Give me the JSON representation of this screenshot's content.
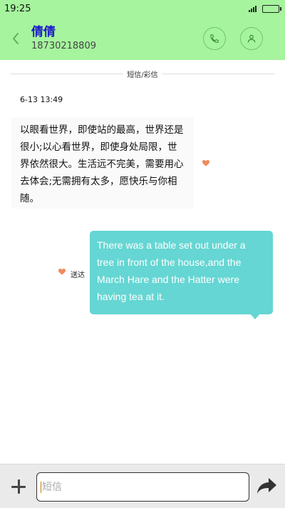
{
  "status_bar": {
    "time": "19:25",
    "signal_icon": "signal-icon",
    "battery_icon": "battery-icon"
  },
  "header": {
    "contact_name": "倩倩",
    "contact_number": "18730218809",
    "back_icon": "chevron-left-icon",
    "call_icon": "phone-icon",
    "profile_icon": "person-icon"
  },
  "conversation": {
    "divider_label": "短信/彩信",
    "timestamp": "6-13 13:49",
    "incoming_message": "以眼看世界，即使站的最高，世界还是很小;以心看世界，即使身处局限，世界依然很大。生活远不完美，需要用心去体会;无需拥有太多，愿快乐与你相随。",
    "outgoing_message": "There was a table set out under a tree in front of the house,and the March Hare and the Hatter were having tea at it.",
    "outgoing_status": "送达",
    "heart_icon": "heart-icon"
  },
  "input_bar": {
    "placeholder": "短信",
    "value": "",
    "add_icon": "plus-icon",
    "send_icon": "send-arrow-icon"
  },
  "colors": {
    "header_bg": "#a6f49e",
    "contact_name": "#1a1ac9",
    "outgoing_bubble": "#65d6d3",
    "heart": "#f08a5d"
  }
}
